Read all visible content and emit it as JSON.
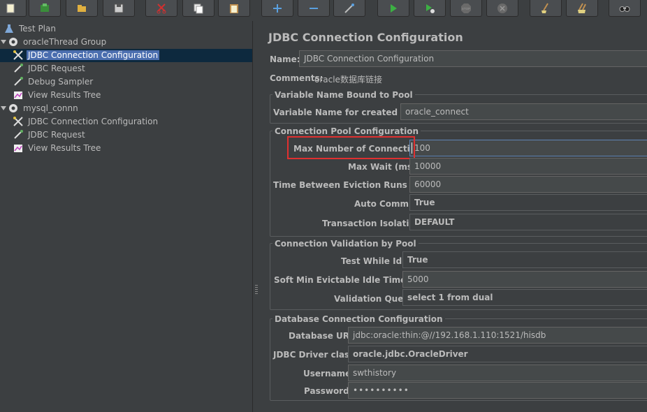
{
  "toolbar": {
    "buttons": [
      {
        "name": "new-icon"
      },
      {
        "name": "templates-icon"
      },
      {
        "name": "open-icon"
      },
      {
        "name": "save-icon"
      },
      {
        "name": "cut-icon"
      },
      {
        "name": "copy-icon"
      },
      {
        "name": "paste-icon"
      },
      {
        "name": "expand-icon"
      },
      {
        "name": "collapse-icon"
      },
      {
        "name": "toggle-icon"
      },
      {
        "name": "start-icon"
      },
      {
        "name": "start-no-pauses-icon"
      },
      {
        "name": "stop-icon"
      },
      {
        "name": "shutdown-icon"
      },
      {
        "name": "clear-icon"
      },
      {
        "name": "clear-all-icon"
      },
      {
        "name": "search-icon"
      }
    ],
    "stop_label": "STOP"
  },
  "tree": {
    "items": [
      {
        "label": "Test Plan",
        "icon": "flask-icon"
      },
      {
        "label": "oracleThread Group",
        "icon": "gear-icon"
      },
      {
        "label": "JDBC Connection Configuration",
        "icon": "tools-icon"
      },
      {
        "label": "JDBC Request",
        "icon": "pipette-icon"
      },
      {
        "label": "Debug Sampler",
        "icon": "pipette-icon"
      },
      {
        "label": "View Results Tree",
        "icon": "chart-icon"
      },
      {
        "label": "mysql_connn",
        "icon": "gear-icon"
      },
      {
        "label": "JDBC Connection Configuration",
        "icon": "tools-icon"
      },
      {
        "label": "JDBC Request",
        "icon": "pipette-icon"
      },
      {
        "label": "View Results Tree",
        "icon": "chart-icon"
      }
    ]
  },
  "panel": {
    "title": "JDBC Connection Configuration",
    "name_label": "Name:",
    "name_value": "JDBC Connection Configuration",
    "comments_label": "Comments:",
    "comments_value": "oracle数据库链接",
    "variable_group": {
      "title": "Variable Name Bound to Pool",
      "label": "Variable Name for created pool:",
      "value": "oracle_connect"
    },
    "pool_group": {
      "title": "Connection Pool Configuration",
      "max_conn_label": "Max Number of Connections:",
      "max_conn_value": "100",
      "max_wait_label": "Max Wait (ms):",
      "max_wait_value": "10000",
      "eviction_label": "Time Between Eviction Runs (ms):",
      "eviction_value": "60000",
      "auto_commit_label": "Auto Commit:",
      "auto_commit_value": "True",
      "isolation_label": "Transaction Isolation:",
      "isolation_value": "DEFAULT"
    },
    "validation_group": {
      "title": "Connection Validation by Pool",
      "test_idle_label": "Test While Idle:",
      "test_idle_value": "True",
      "soft_min_label": "Soft Min Evictable Idle Time(ms):",
      "soft_min_value": "5000",
      "query_label": "Validation Query:",
      "query_value": "select 1 from dual"
    },
    "db_group": {
      "title": "Database Connection Configuration",
      "url_label": "Database URL:",
      "url_value": "jdbc:oracle:thin:@//192.168.1.110:1521/hisdb",
      "driver_label": "JDBC Driver class:",
      "driver_value": "oracle.jdbc.OracleDriver",
      "username_label": "Username:",
      "username_value": "swthistory",
      "password_label": "Password:",
      "password_value": "••••••••••"
    }
  },
  "colors": {
    "background": "#3c3f41",
    "selection": "#4b6eaf",
    "highlight": "#e03030"
  }
}
